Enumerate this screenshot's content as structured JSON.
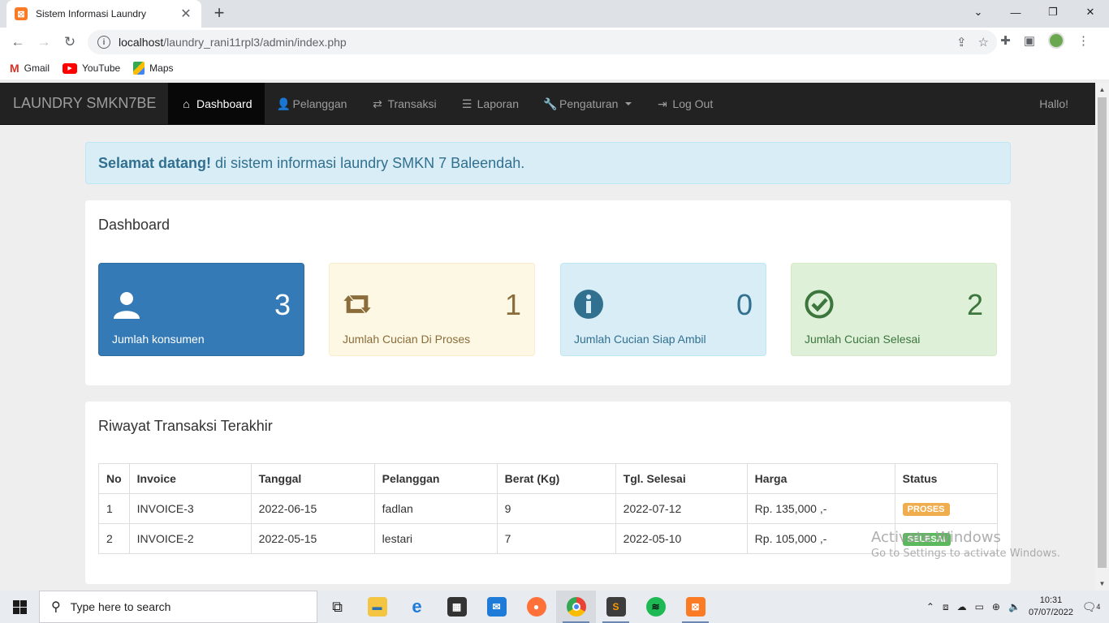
{
  "browser": {
    "tab_title": "Sistem Informasi Laundry",
    "url_host": "localhost",
    "url_path": "/laundry_rani11rpl3/admin/index.php",
    "bookmarks": [
      {
        "label": "Gmail",
        "icon": "gmail-icon"
      },
      {
        "label": "YouTube",
        "icon": "youtube-icon"
      },
      {
        "label": "Maps",
        "icon": "maps-icon"
      }
    ]
  },
  "navbar": {
    "brand": "LAUNDRY SMKN7BE",
    "items": [
      {
        "label": "Dashboard",
        "icon": "home-icon",
        "active": true
      },
      {
        "label": "Pelanggan",
        "icon": "user-icon"
      },
      {
        "label": "Transaksi",
        "icon": "shuffle-icon"
      },
      {
        "label": "Laporan",
        "icon": "list-icon"
      },
      {
        "label": "Pengaturan",
        "icon": "wrench-icon",
        "dropdown": true
      },
      {
        "label": "Log Out",
        "icon": "logout-icon"
      }
    ],
    "greeting": "Hallo!"
  },
  "welcome": {
    "bold": "Selamat datang!",
    "text": "di sistem informasi laundry SMKN 7 Baleendah."
  },
  "dashboard": {
    "title": "Dashboard",
    "cards": [
      {
        "value": "3",
        "label": "Jumlah konsumen",
        "icon": "user-icon",
        "color": "#337ab7"
      },
      {
        "value": "1",
        "label": "Jumlah Cucian Di Proses",
        "icon": "retweet-icon",
        "color": "#fcf8e3"
      },
      {
        "value": "0",
        "label": "Jumlah Cucian Siap Ambil",
        "icon": "info-circle-icon",
        "color": "#d9edf7"
      },
      {
        "value": "2",
        "label": "Jumlah Cucian Selesai",
        "icon": "check-circle-icon",
        "color": "#dff0d8"
      }
    ]
  },
  "history": {
    "title": "Riwayat Transaksi Terakhir",
    "columns": [
      "No",
      "Invoice",
      "Tanggal",
      "Pelanggan",
      "Berat (Kg)",
      "Tgl. Selesai",
      "Harga",
      "Status"
    ],
    "rows": [
      {
        "no": "1",
        "invoice": "INVOICE-3",
        "tanggal": "2022-06-15",
        "pelanggan": "fadlan",
        "berat": "9",
        "selesai": "2022-07-12",
        "harga": "Rp. 135,000 ,-",
        "status": "PROSES",
        "status_color": "#f0ad4e"
      },
      {
        "no": "2",
        "invoice": "INVOICE-2",
        "tanggal": "2022-05-15",
        "pelanggan": "lestari",
        "berat": "7",
        "selesai": "2022-05-10",
        "harga": "Rp. 105,000 ,-",
        "status": "SELESAI",
        "status_color": "#5cb85c"
      }
    ]
  },
  "watermark": {
    "line1": "Activate Windows",
    "line2": "Go to Settings to activate Windows."
  },
  "taskbar": {
    "search_placeholder": "Type here to search",
    "time": "10:31",
    "date": "07/07/2022",
    "notification_count": "4"
  }
}
